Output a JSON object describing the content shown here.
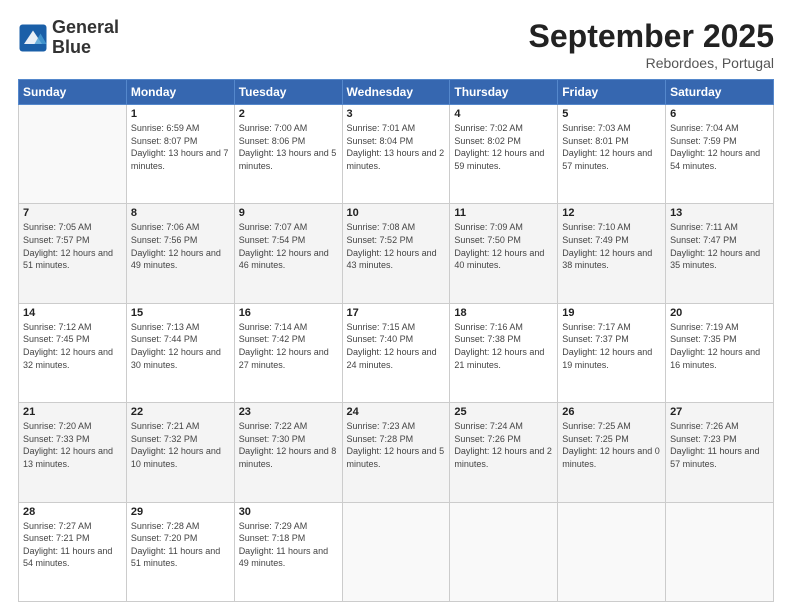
{
  "logo": {
    "line1": "General",
    "line2": "Blue"
  },
  "title": "September 2025",
  "subtitle": "Rebordoes, Portugal",
  "weekdays": [
    "Sunday",
    "Monday",
    "Tuesday",
    "Wednesday",
    "Thursday",
    "Friday",
    "Saturday"
  ],
  "weeks": [
    [
      {
        "date": "",
        "sunrise": "",
        "sunset": "",
        "daylight": ""
      },
      {
        "date": "1",
        "sunrise": "Sunrise: 6:59 AM",
        "sunset": "Sunset: 8:07 PM",
        "daylight": "Daylight: 13 hours and 7 minutes."
      },
      {
        "date": "2",
        "sunrise": "Sunrise: 7:00 AM",
        "sunset": "Sunset: 8:06 PM",
        "daylight": "Daylight: 13 hours and 5 minutes."
      },
      {
        "date": "3",
        "sunrise": "Sunrise: 7:01 AM",
        "sunset": "Sunset: 8:04 PM",
        "daylight": "Daylight: 13 hours and 2 minutes."
      },
      {
        "date": "4",
        "sunrise": "Sunrise: 7:02 AM",
        "sunset": "Sunset: 8:02 PM",
        "daylight": "Daylight: 12 hours and 59 minutes."
      },
      {
        "date": "5",
        "sunrise": "Sunrise: 7:03 AM",
        "sunset": "Sunset: 8:01 PM",
        "daylight": "Daylight: 12 hours and 57 minutes."
      },
      {
        "date": "6",
        "sunrise": "Sunrise: 7:04 AM",
        "sunset": "Sunset: 7:59 PM",
        "daylight": "Daylight: 12 hours and 54 minutes."
      }
    ],
    [
      {
        "date": "7",
        "sunrise": "Sunrise: 7:05 AM",
        "sunset": "Sunset: 7:57 PM",
        "daylight": "Daylight: 12 hours and 51 minutes."
      },
      {
        "date": "8",
        "sunrise": "Sunrise: 7:06 AM",
        "sunset": "Sunset: 7:56 PM",
        "daylight": "Daylight: 12 hours and 49 minutes."
      },
      {
        "date": "9",
        "sunrise": "Sunrise: 7:07 AM",
        "sunset": "Sunset: 7:54 PM",
        "daylight": "Daylight: 12 hours and 46 minutes."
      },
      {
        "date": "10",
        "sunrise": "Sunrise: 7:08 AM",
        "sunset": "Sunset: 7:52 PM",
        "daylight": "Daylight: 12 hours and 43 minutes."
      },
      {
        "date": "11",
        "sunrise": "Sunrise: 7:09 AM",
        "sunset": "Sunset: 7:50 PM",
        "daylight": "Daylight: 12 hours and 40 minutes."
      },
      {
        "date": "12",
        "sunrise": "Sunrise: 7:10 AM",
        "sunset": "Sunset: 7:49 PM",
        "daylight": "Daylight: 12 hours and 38 minutes."
      },
      {
        "date": "13",
        "sunrise": "Sunrise: 7:11 AM",
        "sunset": "Sunset: 7:47 PM",
        "daylight": "Daylight: 12 hours and 35 minutes."
      }
    ],
    [
      {
        "date": "14",
        "sunrise": "Sunrise: 7:12 AM",
        "sunset": "Sunset: 7:45 PM",
        "daylight": "Daylight: 12 hours and 32 minutes."
      },
      {
        "date": "15",
        "sunrise": "Sunrise: 7:13 AM",
        "sunset": "Sunset: 7:44 PM",
        "daylight": "Daylight: 12 hours and 30 minutes."
      },
      {
        "date": "16",
        "sunrise": "Sunrise: 7:14 AM",
        "sunset": "Sunset: 7:42 PM",
        "daylight": "Daylight: 12 hours and 27 minutes."
      },
      {
        "date": "17",
        "sunrise": "Sunrise: 7:15 AM",
        "sunset": "Sunset: 7:40 PM",
        "daylight": "Daylight: 12 hours and 24 minutes."
      },
      {
        "date": "18",
        "sunrise": "Sunrise: 7:16 AM",
        "sunset": "Sunset: 7:38 PM",
        "daylight": "Daylight: 12 hours and 21 minutes."
      },
      {
        "date": "19",
        "sunrise": "Sunrise: 7:17 AM",
        "sunset": "Sunset: 7:37 PM",
        "daylight": "Daylight: 12 hours and 19 minutes."
      },
      {
        "date": "20",
        "sunrise": "Sunrise: 7:19 AM",
        "sunset": "Sunset: 7:35 PM",
        "daylight": "Daylight: 12 hours and 16 minutes."
      }
    ],
    [
      {
        "date": "21",
        "sunrise": "Sunrise: 7:20 AM",
        "sunset": "Sunset: 7:33 PM",
        "daylight": "Daylight: 12 hours and 13 minutes."
      },
      {
        "date": "22",
        "sunrise": "Sunrise: 7:21 AM",
        "sunset": "Sunset: 7:32 PM",
        "daylight": "Daylight: 12 hours and 10 minutes."
      },
      {
        "date": "23",
        "sunrise": "Sunrise: 7:22 AM",
        "sunset": "Sunset: 7:30 PM",
        "daylight": "Daylight: 12 hours and 8 minutes."
      },
      {
        "date": "24",
        "sunrise": "Sunrise: 7:23 AM",
        "sunset": "Sunset: 7:28 PM",
        "daylight": "Daylight: 12 hours and 5 minutes."
      },
      {
        "date": "25",
        "sunrise": "Sunrise: 7:24 AM",
        "sunset": "Sunset: 7:26 PM",
        "daylight": "Daylight: 12 hours and 2 minutes."
      },
      {
        "date": "26",
        "sunrise": "Sunrise: 7:25 AM",
        "sunset": "Sunset: 7:25 PM",
        "daylight": "Daylight: 12 hours and 0 minutes."
      },
      {
        "date": "27",
        "sunrise": "Sunrise: 7:26 AM",
        "sunset": "Sunset: 7:23 PM",
        "daylight": "Daylight: 11 hours and 57 minutes."
      }
    ],
    [
      {
        "date": "28",
        "sunrise": "Sunrise: 7:27 AM",
        "sunset": "Sunset: 7:21 PM",
        "daylight": "Daylight: 11 hours and 54 minutes."
      },
      {
        "date": "29",
        "sunrise": "Sunrise: 7:28 AM",
        "sunset": "Sunset: 7:20 PM",
        "daylight": "Daylight: 11 hours and 51 minutes."
      },
      {
        "date": "30",
        "sunrise": "Sunrise: 7:29 AM",
        "sunset": "Sunset: 7:18 PM",
        "daylight": "Daylight: 11 hours and 49 minutes."
      },
      {
        "date": "",
        "sunrise": "",
        "sunset": "",
        "daylight": ""
      },
      {
        "date": "",
        "sunrise": "",
        "sunset": "",
        "daylight": ""
      },
      {
        "date": "",
        "sunrise": "",
        "sunset": "",
        "daylight": ""
      },
      {
        "date": "",
        "sunrise": "",
        "sunset": "",
        "daylight": ""
      }
    ]
  ]
}
